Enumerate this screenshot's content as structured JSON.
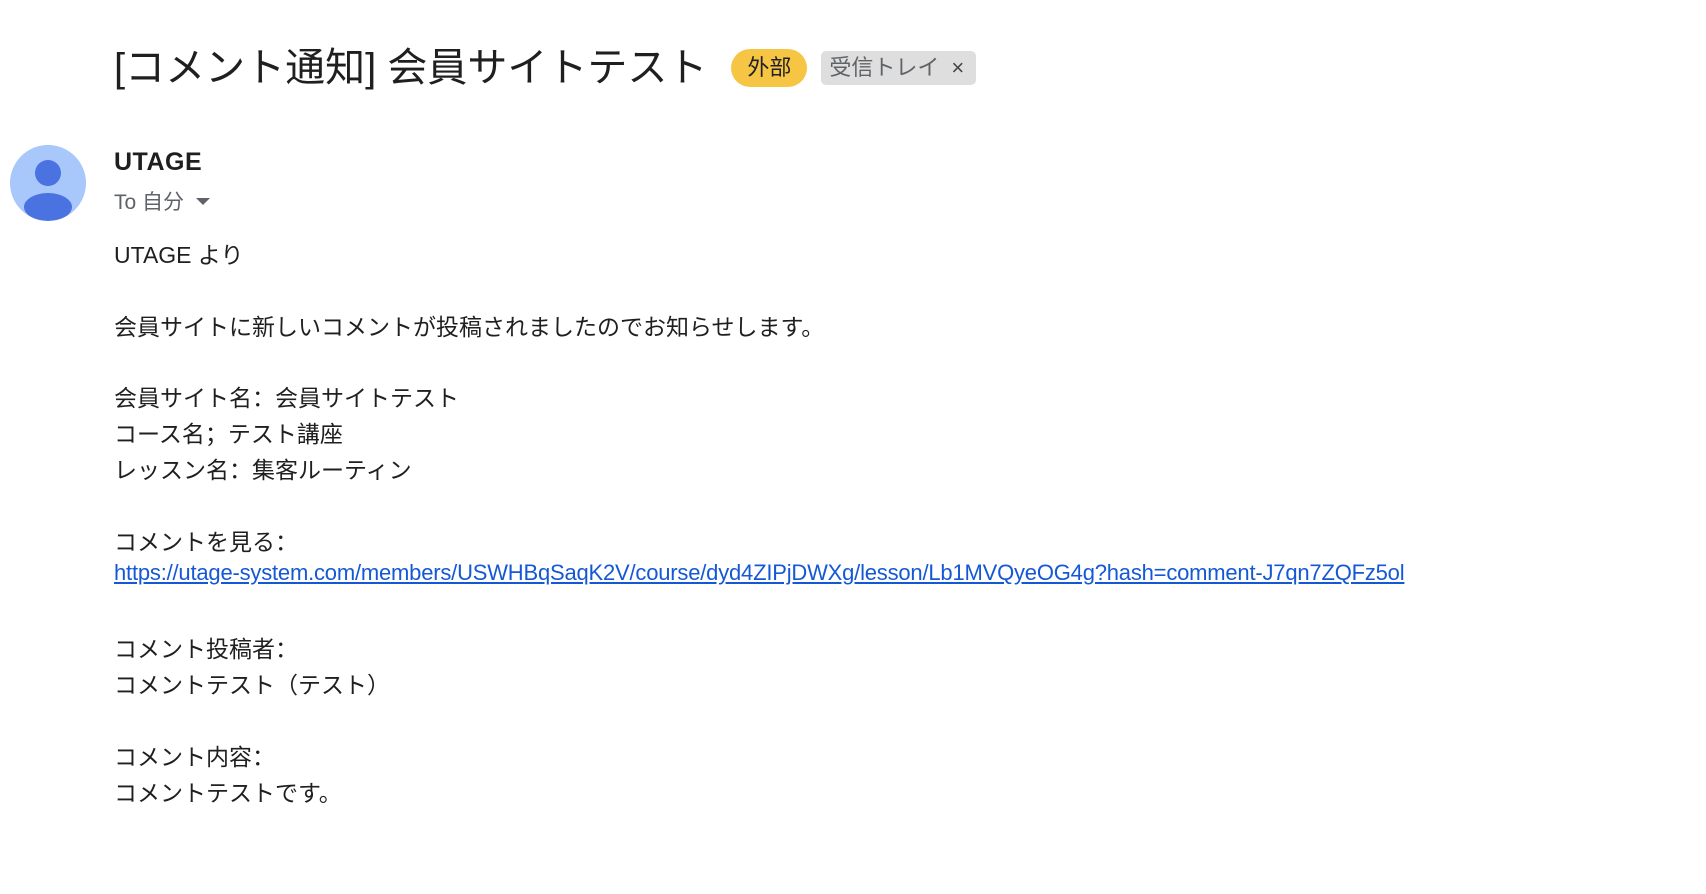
{
  "email": {
    "subject": "[コメント通知] 会員サイトテスト",
    "labels": {
      "external": "外部",
      "inbox": "受信トレイ",
      "remove": "×"
    },
    "sender": {
      "name": "UTAGE",
      "avatar_icon": "person-icon",
      "to_label": "To 自分",
      "caret_icon": "chevron-down-icon"
    },
    "body": {
      "greeting": "UTAGE より",
      "intro": "会員サイトに新しいコメントが投稿されましたのでお知らせします。",
      "site_line": "会員サイト名：会員サイトテスト",
      "course_line": "コース名；テスト講座",
      "lesson_line": "レッスン名：集客ルーティン",
      "view_label": "コメントを見る：",
      "comment_url": "https://utage-system.com/members/USWHBqSaqK2V/course/dyd4ZIPjDWXg/lesson/Lb1MVQyeOG4g?hash=comment-J7qn7ZQFz5ol",
      "poster_label": "コメント投稿者：",
      "poster_value": "コメントテスト（テスト）",
      "content_label": "コメント内容：",
      "content_value": "コメントテストです。"
    }
  },
  "colors": {
    "external_label_bg": "#f7c544",
    "inbox_label_bg": "#dedede",
    "avatar_bg": "#a8c7fa",
    "avatar_fg": "#4a72e0",
    "link": "#1558d6"
  }
}
